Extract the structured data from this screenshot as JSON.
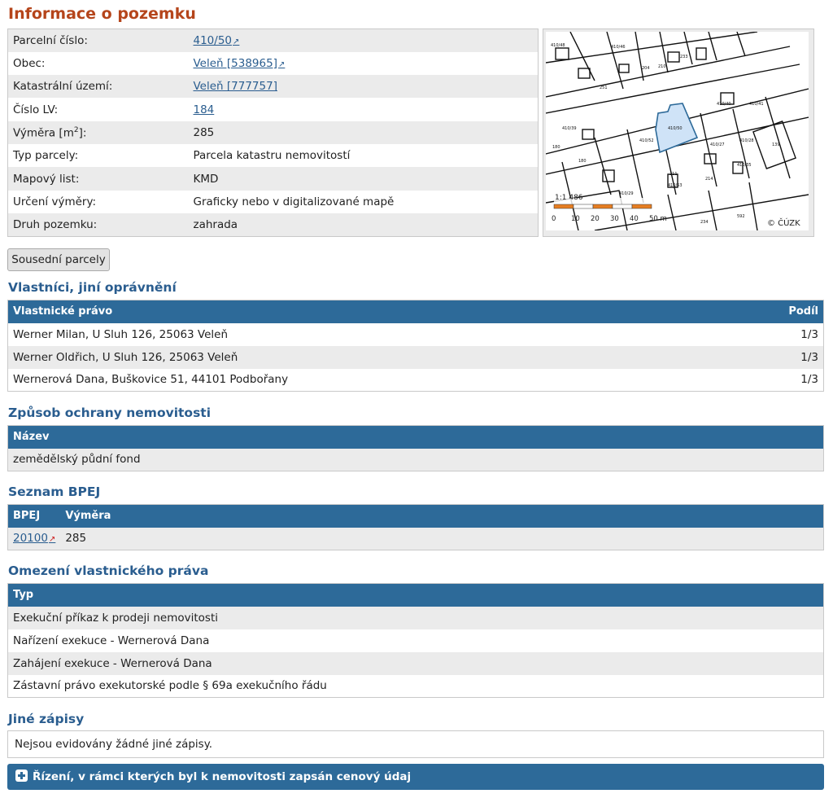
{
  "title": "Informace o pozemku",
  "info": {
    "parcel_number_label": "Parcelní číslo:",
    "parcel_number_value": "410/50",
    "municipality_label": "Obec:",
    "municipality_value": "Veleň [538965]",
    "cadastral_area_label": "Katastrální území:",
    "cadastral_area_value": "Veleň [777757]",
    "lv_number_label": "Číslo LV:",
    "lv_number_value": "184",
    "area_label_prefix": "Výměra [m",
    "area_label_sup": "2",
    "area_label_suffix": "]:",
    "area_value": "285",
    "parcel_type_label": "Typ parcely:",
    "parcel_type_value": "Parcela katastru nemovitostí",
    "map_sheet_label": "Mapový list:",
    "map_sheet_value": "KMD",
    "area_determination_label": "Určení výměry:",
    "area_determination_value": "Graficky nebo v digitalizované mapě",
    "land_type_label": "Druh pozemku:",
    "land_type_value": "zahrada",
    "external_icon": "↗"
  },
  "map": {
    "scale_text": "1:1 486",
    "scale_ticks": [
      "0",
      "10",
      "20",
      "30",
      "40",
      "50 m"
    ],
    "copyright": "© ČÚZK",
    "parcel_labels": [
      "410/50",
      "410/52",
      "410/53",
      "410/40",
      "410/27",
      "410/41",
      "410/29",
      "410/28",
      "410/46",
      "410/48",
      "410/35",
      "410/39",
      "139",
      "180",
      "180",
      "211",
      "204",
      "210",
      "214",
      "233",
      "234",
      "251",
      "592"
    ],
    "highlight_color": "#cfe3f7"
  },
  "neighbors_button": "Sousední parcely",
  "owners": {
    "heading": "Vlastníci, jiní oprávnění",
    "col_right": "Vlastnické právo",
    "col_share": "Podíl",
    "rows": [
      {
        "name": "Werner Milan, U Sluh 126, 25063 Veleň",
        "share": "1/3"
      },
      {
        "name": "Werner Oldřich, U Sluh 126, 25063 Veleň",
        "share": "1/3"
      },
      {
        "name": "Wernerová Dana, Buškovice 51, 44101 Podbořany",
        "share": "1/3"
      }
    ]
  },
  "protection": {
    "heading": "Způsob ochrany nemovitosti",
    "col_name": "Název",
    "rows": [
      {
        "name": "zemědělský půdní fond"
      }
    ]
  },
  "bpej": {
    "heading": "Seznam BPEJ",
    "col_bpej": "BPEJ",
    "col_area": "Výměra",
    "rows": [
      {
        "code": "20100",
        "area": "285"
      }
    ]
  },
  "restrictions": {
    "heading": "Omezení vlastnického práva",
    "col_type": "Typ",
    "rows": [
      {
        "type": "Exekuční příkaz k prodeji nemovitosti"
      },
      {
        "type": "Nařízení exekuce - Wernerová Dana"
      },
      {
        "type": "Zahájení exekuce - Wernerová Dana"
      },
      {
        "type": "Zástavní právo exekutorské podle § 69a exekučního řádu"
      }
    ]
  },
  "other": {
    "heading": "Jiné zápisy",
    "text": "Nejsou evidovány žádné jiné zápisy."
  },
  "proceedings": {
    "label": "Řízení, v rámci kterých byl k nemovitosti zapsán cenový údaj",
    "icon": "plus-icon"
  },
  "colors": {
    "title": "#b5451b",
    "heading": "#2a5d8f",
    "table_header": "#2d6a99",
    "link": "#2a5d8f",
    "bpej_icon": "#cc2222"
  }
}
